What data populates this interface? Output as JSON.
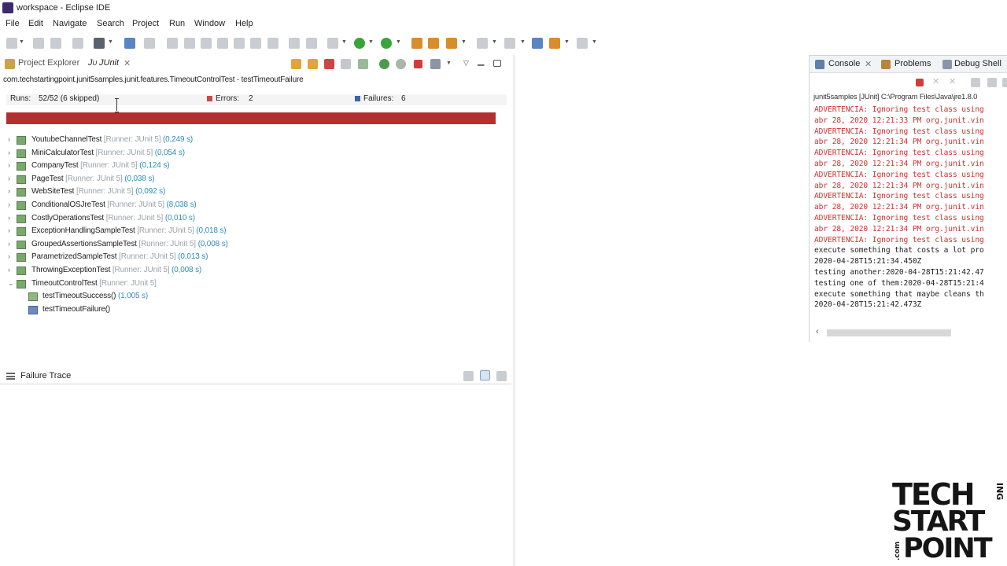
{
  "window": {
    "title": "workspace - Eclipse IDE"
  },
  "menu": [
    "File",
    "Edit",
    "Navigate",
    "Search",
    "Project",
    "Run",
    "Window",
    "Help"
  ],
  "left_tabs": {
    "project_explorer": "Project Explorer",
    "junit": "JUnit"
  },
  "junit": {
    "title": "com.techstartingpoint.junit5samples.junit.features.TimeoutControlTest - testTimeoutFailure",
    "runs_label": "Runs:",
    "runs_value": "52/52 (6 skipped)",
    "errors_label": "Errors:",
    "errors_value": "2",
    "failures_label": "Failures:",
    "failures_value": "6",
    "progress_color": "#b33030",
    "tests": [
      {
        "name": "YoutubeChannelTest",
        "runner": "[Runner: JUnit 5]",
        "time": "(0,249 s)"
      },
      {
        "name": "MiniCalculatorTest",
        "runner": "[Runner: JUnit 5]",
        "time": "(0,054 s)"
      },
      {
        "name": "CompanyTest",
        "runner": "[Runner: JUnit 5]",
        "time": "(0,124 s)"
      },
      {
        "name": "PageTest",
        "runner": "[Runner: JUnit 5]",
        "time": "(0,038 s)"
      },
      {
        "name": "WebSiteTest",
        "runner": "[Runner: JUnit 5]",
        "time": "(0,092 s)"
      },
      {
        "name": "ConditionalOSJreTest",
        "runner": "[Runner: JUnit 5]",
        "time": "(8,038 s)"
      },
      {
        "name": "CostlyOperationsTest",
        "runner": "[Runner: JUnit 5]",
        "time": "(0,010 s)"
      },
      {
        "name": "ExceptionHandlingSampleTest",
        "runner": "[Runner: JUnit 5]",
        "time": "(0,018 s)"
      },
      {
        "name": "GroupedAssertionsSampleTest",
        "runner": "[Runner: JUnit 5]",
        "time": "(0,008 s)"
      },
      {
        "name": "ParametrizedSampleTest",
        "runner": "[Runner: JUnit 5]",
        "time": "(0,013 s)"
      },
      {
        "name": "ThrowingExceptionTest",
        "runner": "[Runner: JUnit 5]",
        "time": "(0,008 s)"
      },
      {
        "name": "TimeoutControlTest",
        "runner": "[Runner: JUnit 5]",
        "time": ""
      }
    ],
    "children": [
      {
        "name": "testTimeoutSuccess()",
        "time": "(1,005 s)"
      },
      {
        "name": "testTimeoutFailure()",
        "time": ""
      }
    ]
  },
  "failure_trace": {
    "label": "Failure Trace"
  },
  "console": {
    "tabs": {
      "console": "Console",
      "problems": "Problems",
      "debug_shell": "Debug Shell"
    },
    "description": "junit5samples [JUnit] C:\\Program Files\\Java\\jre1.8.0",
    "lines": [
      {
        "kind": "err",
        "text": "ADVERTENCIA: Ignoring test class using"
      },
      {
        "kind": "err",
        "text": "abr 28, 2020 12:21:33 PM org.junit.vin"
      },
      {
        "kind": "err",
        "text": "ADVERTENCIA: Ignoring test class using"
      },
      {
        "kind": "err",
        "text": "abr 28, 2020 12:21:34 PM org.junit.vin"
      },
      {
        "kind": "err",
        "text": "ADVERTENCIA: Ignoring test class using"
      },
      {
        "kind": "err",
        "text": "abr 28, 2020 12:21:34 PM org.junit.vin"
      },
      {
        "kind": "err",
        "text": "ADVERTENCIA: Ignoring test class using"
      },
      {
        "kind": "err",
        "text": "abr 28, 2020 12:21:34 PM org.junit.vin"
      },
      {
        "kind": "err",
        "text": "ADVERTENCIA: Ignoring test class using"
      },
      {
        "kind": "err",
        "text": "abr 28, 2020 12:21:34 PM org.junit.vin"
      },
      {
        "kind": "err",
        "text": "ADVERTENCIA: Ignoring test class using"
      },
      {
        "kind": "err",
        "text": "abr 28, 2020 12:21:34 PM org.junit.vin"
      },
      {
        "kind": "err",
        "text": "ADVERTENCIA: Ignoring test class using"
      },
      {
        "kind": "out",
        "text": "execute something that costs a lot pro"
      },
      {
        "kind": "out",
        "text": "2020-04-28T15:21:34.450Z"
      },
      {
        "kind": "out",
        "text": "testing another:2020-04-28T15:21:42.47"
      },
      {
        "kind": "out",
        "text": "testing one of them:2020-04-28T15:21:4"
      },
      {
        "kind": "out",
        "text": "execute something that maybe cleans th"
      },
      {
        "kind": "out",
        "text": "2020-04-28T15:21:42.473Z"
      }
    ]
  },
  "logo": {
    "tech": "TECH",
    "ing": "ING",
    "start": "START",
    "com": ".com",
    "point": "POINT"
  }
}
